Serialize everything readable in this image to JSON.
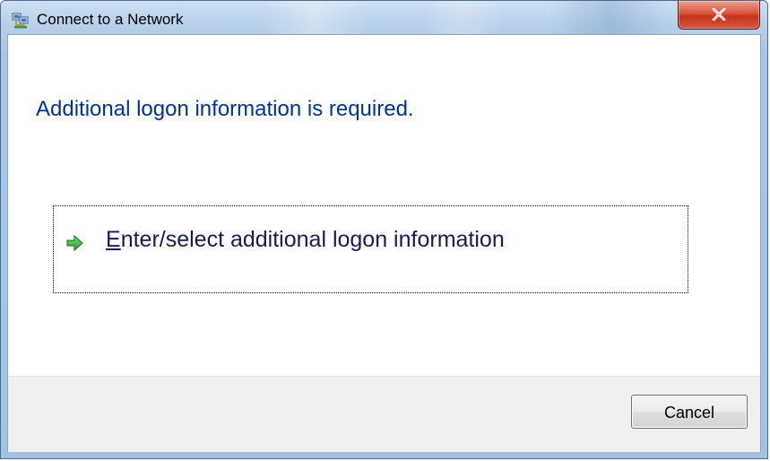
{
  "window": {
    "title": "Connect to a Network",
    "icon": "network-icon",
    "close_icon": "close-icon"
  },
  "content": {
    "main_instruction": "Additional logon information is required.",
    "command_link": {
      "icon": "green-arrow-icon",
      "accelerator": "E",
      "label_rest": "nter/select additional logon information"
    }
  },
  "footer": {
    "cancel_label": "Cancel"
  },
  "colors": {
    "instruction": "#003399",
    "command_link_text": "#151c55",
    "close_button": "#c5331c"
  }
}
